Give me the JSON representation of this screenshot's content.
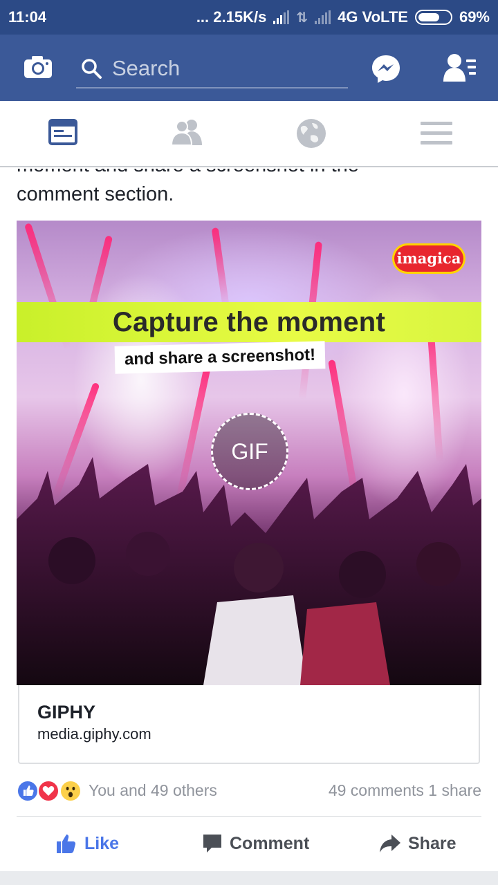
{
  "status_bar": {
    "time": "11:04",
    "network_speed": "... 2.15K/s",
    "network_type": "4G VoLTE",
    "battery": "69%",
    "battery_level": 0.69
  },
  "app_bar": {
    "search_placeholder": "Search"
  },
  "tabs": [
    {
      "name": "news-feed",
      "active": true
    },
    {
      "name": "friends",
      "active": false
    },
    {
      "name": "notifications",
      "active": false
    },
    {
      "name": "menu",
      "active": false
    }
  ],
  "post": {
    "text_partial_top": "moment and share a screenshot in the",
    "text_line": "comment section.",
    "gif_overlay": {
      "badge_text": "imagica",
      "title": "Capture the moment",
      "subtitle": "and share a screenshot!",
      "gif_label": "GIF"
    },
    "link": {
      "title": "GIPHY",
      "domain": "media.giphy.com"
    },
    "reactions_text": "You and 49 others",
    "counts_text": "49 comments 1 share",
    "actions": {
      "like": "Like",
      "comment": "Comment",
      "share": "Share"
    }
  },
  "colors": {
    "brand": "#3b5998",
    "status_bar": "#2c4a86",
    "like_blue": "#4a76e8",
    "banner_green": "#d8f540"
  }
}
